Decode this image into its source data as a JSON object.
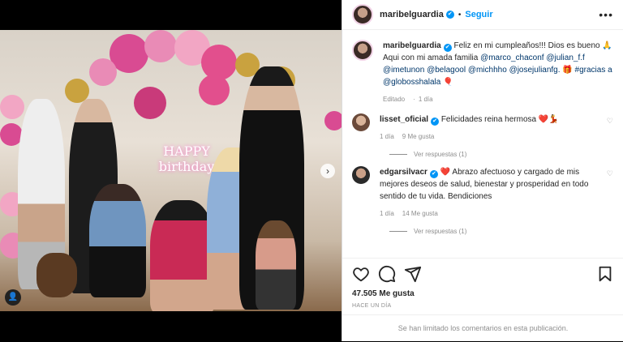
{
  "header": {
    "username": "maribelguardia",
    "verified_mark": "✔",
    "follow_label": "Seguir",
    "more_icon": "more-horizontal-icon"
  },
  "caption": {
    "username": "maribelguardia",
    "text_1": "Feliz en mi cumpleaños!!! Dios es bueno 🙏 Aqui con mi amada familia ",
    "mentions": [
      "@marco_chaconf",
      "@julian_f.f",
      "@imetunon",
      "@belagool",
      "@michhho",
      "@josejulianfg."
    ],
    "text_2": " 🎁 ",
    "hashtag": "#gracias a @globosshalala",
    "edited": "Editado",
    "time": "1 día"
  },
  "comments": [
    {
      "username": "lisset_oficial",
      "text": "Felicidades reina hermosa ❤️💃",
      "time": "1 día",
      "likes": "9 Me gusta",
      "replies": "Ver respuestas (1)"
    },
    {
      "username": "edgarsilvacr",
      "text": "❤️ Abrazo afectuoso y cargado de mis mejores deseos de salud, bienestar y prosperidad en todo sentido de tu vida. Bendiciones",
      "time": "1 día",
      "likes": "14 Me gusta",
      "replies": "Ver respuestas (1)"
    }
  ],
  "actions": {
    "likes": "47.505 Me gusta",
    "date": "HACE UN DÍA"
  },
  "footer": {
    "limited": "Se han limitado los comentarios en esta publicación."
  },
  "media": {
    "balloon_text": "HAPPY birthday"
  },
  "colors": {
    "accent": "#0095f6",
    "heart": "#e0245e"
  }
}
